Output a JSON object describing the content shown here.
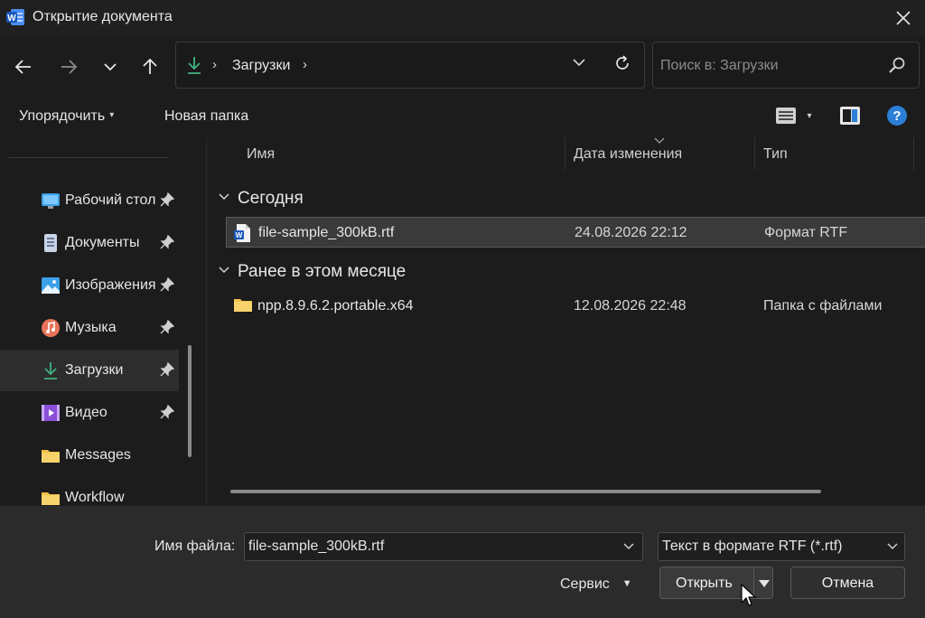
{
  "window": {
    "title": "Открытие документа",
    "app_icon": "word-icon",
    "close_icon": "close-icon"
  },
  "nav": {
    "back_icon": "arrow-left-icon",
    "forward_icon": "arrow-right-icon",
    "recent_icon": "chevron-down-icon",
    "up_icon": "arrow-up-icon",
    "address": {
      "icon": "download-icon",
      "crumb": "Загрузки",
      "refresh_icon": "refresh-icon"
    },
    "search": {
      "placeholder": "Поиск в: Загрузки",
      "icon": "search-icon"
    }
  },
  "commands": {
    "organize": "Упорядочить",
    "new_folder": "Новая папка",
    "view_icon": "list-view-icon",
    "preview_icon": "preview-pane-icon",
    "help_icon": "help-icon"
  },
  "sidebar": {
    "items": [
      {
        "label": "Рабочий стол",
        "icon": "desktop-icon",
        "pinned": true
      },
      {
        "label": "Документы",
        "icon": "documents-icon",
        "pinned": true
      },
      {
        "label": "Изображения",
        "icon": "pictures-icon",
        "pinned": true
      },
      {
        "label": "Музыка",
        "icon": "music-icon",
        "pinned": true
      },
      {
        "label": "Загрузки",
        "icon": "download-icon",
        "pinned": true,
        "active": true
      },
      {
        "label": "Видео",
        "icon": "video-icon",
        "pinned": true
      },
      {
        "label": "Messages",
        "icon": "folder-icon",
        "pinned": false
      },
      {
        "label": "Workflow",
        "icon": "folder-icon",
        "pinned": false
      }
    ]
  },
  "filelist": {
    "columns": [
      "Имя",
      "Дата изменения",
      "Тип"
    ],
    "groups": [
      {
        "label": "Сегодня",
        "files": [
          {
            "name": "file-sample_300kB.rtf",
            "date": "24.08.2026 22:12",
            "type": "Формат RTF",
            "icon": "word-doc-icon",
            "selected": true
          }
        ]
      },
      {
        "label": "Ранее в этом месяце",
        "files": [
          {
            "name": "npp.8.9.6.2.portable.x64",
            "date": "12.08.2026 22:48",
            "type": "Папка с файлами",
            "icon": "folder-icon",
            "selected": false
          }
        ]
      }
    ]
  },
  "footer": {
    "filename_label": "Имя файла:",
    "filename_value": "file-sample_300kB.rtf",
    "filter_value": "Текст в формате RTF (*.rtf)",
    "service_label": "Сервис",
    "open_label": "Открыть",
    "cancel_label": "Отмена"
  },
  "colors": {
    "background": "#1c1c1c",
    "footer": "#2b2b2b",
    "accent_blue": "#2b7fd6",
    "download_green": "#3fb27f",
    "folder_yellow": "#f0c24a"
  }
}
